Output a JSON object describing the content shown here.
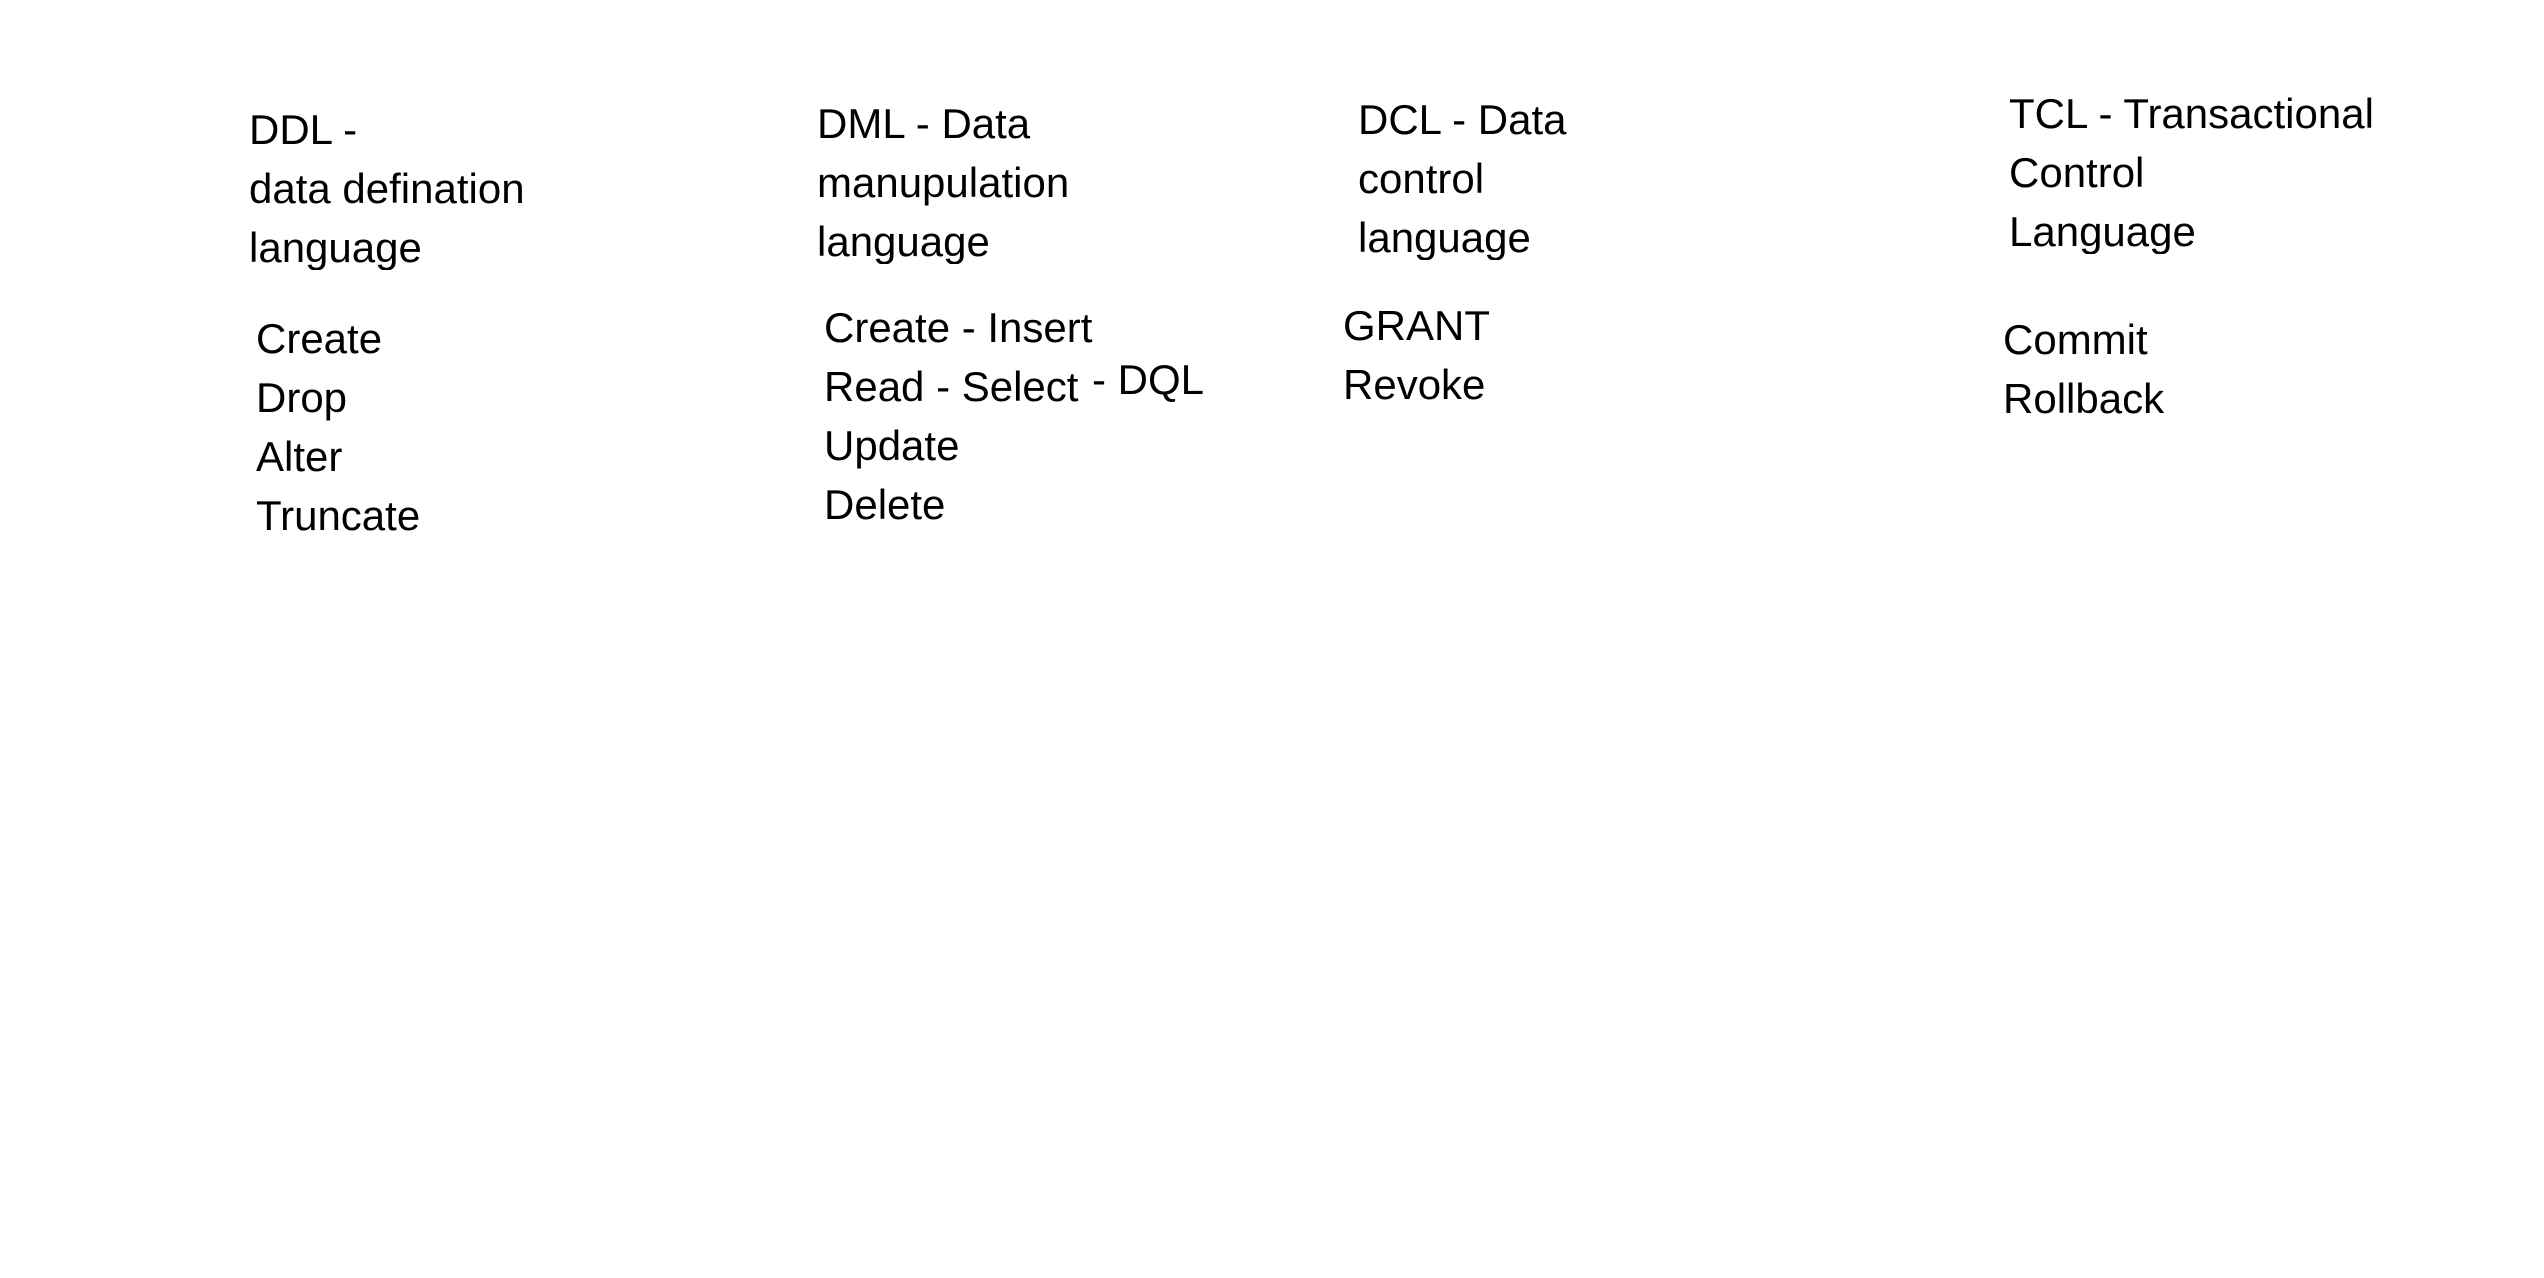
{
  "ddl": {
    "heading_lines": [
      "DDL -",
      "data defination",
      "language"
    ],
    "commands": [
      "Create",
      "Drop",
      "Alter",
      "Truncate"
    ]
  },
  "dml": {
    "heading_lines": [
      "DML - Data",
      "manupulation",
      "language"
    ],
    "commands": [
      "Create - Insert",
      "Read - Select",
      "Update",
      "Delete"
    ],
    "dql_note": "- DQL"
  },
  "dcl": {
    "heading_lines": [
      "DCL - Data",
      "control",
      "language"
    ],
    "commands": [
      "GRANT",
      "Revoke"
    ]
  },
  "tcl": {
    "heading_lines": [
      "TCL - Transactional",
      "Control",
      "Language"
    ],
    "commands": [
      "Commit",
      "Rollback"
    ]
  }
}
